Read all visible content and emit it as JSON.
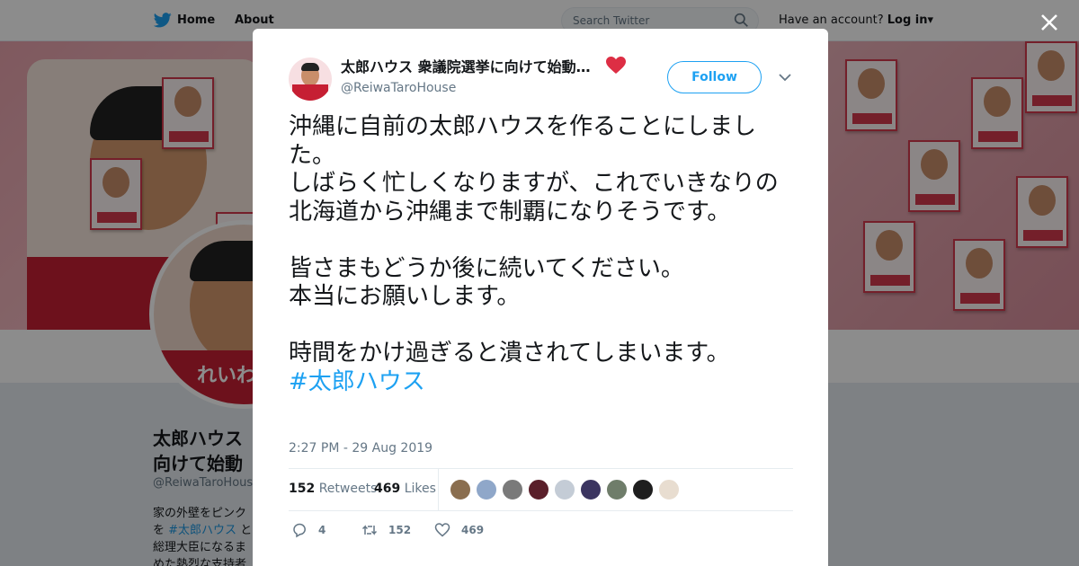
{
  "topbar": {
    "home_label": "Home",
    "about_label": "About",
    "search_placeholder": "Search Twitter",
    "account_prompt": "Have an account?",
    "login_label": "Log in"
  },
  "profile": {
    "name_line1": "太郎ハウス",
    "name_line2": "向けて始動",
    "handle": "@ReiwaTaroHouse",
    "bio_lines": [
      "家の外壁をピンク",
      "を",
      "総理大臣になるま",
      "めた熱烈な支持者"
    ],
    "bio_hashtag": "#太郎ハウス",
    "bio_tail": "と",
    "avatar_label": "れいわ"
  },
  "tweet": {
    "author_name": "太郎ハウス 衆議院選挙に向けて始動…",
    "author_handle": "@ReiwaTaroHouse",
    "follow_label": "Follow",
    "text_lines": [
      "沖縄に自前の太郎ハウスを作ることにしました。",
      "しばらく忙しくなりますが、これでいきなりの北海道から沖縄まで制覇になりそうです。",
      "",
      "皆さまもどうか後に続いてください。",
      "本当にお願いします。",
      "",
      "時間をかけ過ぎると潰されてしまいます。"
    ],
    "hashtag": "#太郎ハウス",
    "timestamp": "2:27 PM - 29 Aug 2019",
    "retweets_count": "152",
    "retweets_label": "Retweets",
    "likes_count": "469",
    "likes_label": "Likes",
    "reply_count": "4",
    "retweet_action_count": "152",
    "like_action_count": "469"
  },
  "colors": {
    "accent": "#1da1f2",
    "heart": "#e0245e",
    "overlay": "rgba(0,0,0,0.45)"
  }
}
